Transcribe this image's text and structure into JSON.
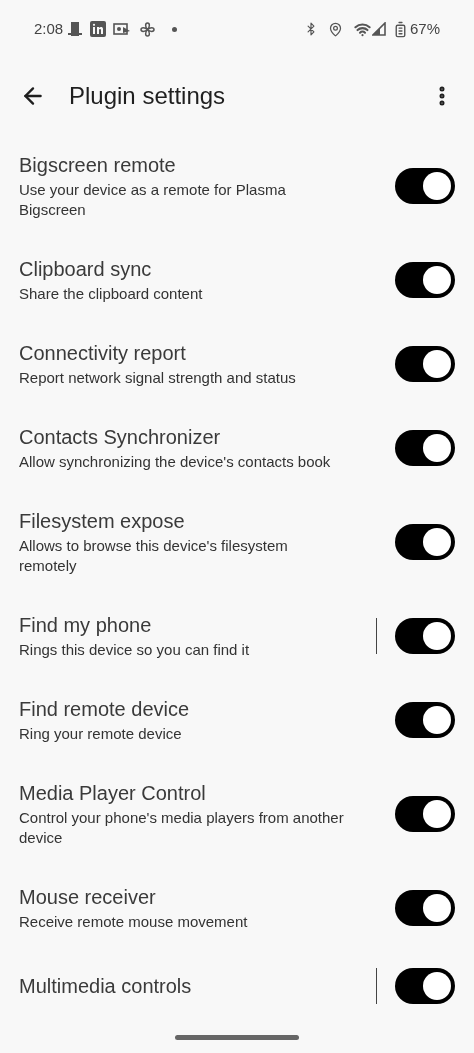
{
  "status_bar": {
    "time": "2:08",
    "battery": "67%"
  },
  "app_bar": {
    "title": "Plugin settings"
  },
  "plugins": [
    {
      "title": "Bigscreen remote",
      "subtitle": "Use your device as a remote for Plasma Bigscreen",
      "on": true,
      "has_settings": false
    },
    {
      "title": "Clipboard sync",
      "subtitle": "Share the clipboard content",
      "on": true,
      "has_settings": false
    },
    {
      "title": "Connectivity report",
      "subtitle": "Report network signal strength and status",
      "on": true,
      "has_settings": false
    },
    {
      "title": "Contacts Synchronizer",
      "subtitle": "Allow synchronizing the device's contacts book",
      "on": true,
      "has_settings": false
    },
    {
      "title": "Filesystem expose",
      "subtitle": "Allows to browse this device's filesystem remotely",
      "on": true,
      "has_settings": false
    },
    {
      "title": "Find my phone",
      "subtitle": "Rings this device so you can find it",
      "on": true,
      "has_settings": true
    },
    {
      "title": "Find remote device",
      "subtitle": "Ring your remote device",
      "on": true,
      "has_settings": false
    },
    {
      "title": "Media Player Control",
      "subtitle": "Control your phone's media players from another device",
      "on": true,
      "has_settings": false
    },
    {
      "title": "Mouse receiver",
      "subtitle": "Receive remote mouse movement",
      "on": true,
      "has_settings": false
    },
    {
      "title": "Multimedia controls",
      "on": true,
      "has_settings": true
    }
  ]
}
